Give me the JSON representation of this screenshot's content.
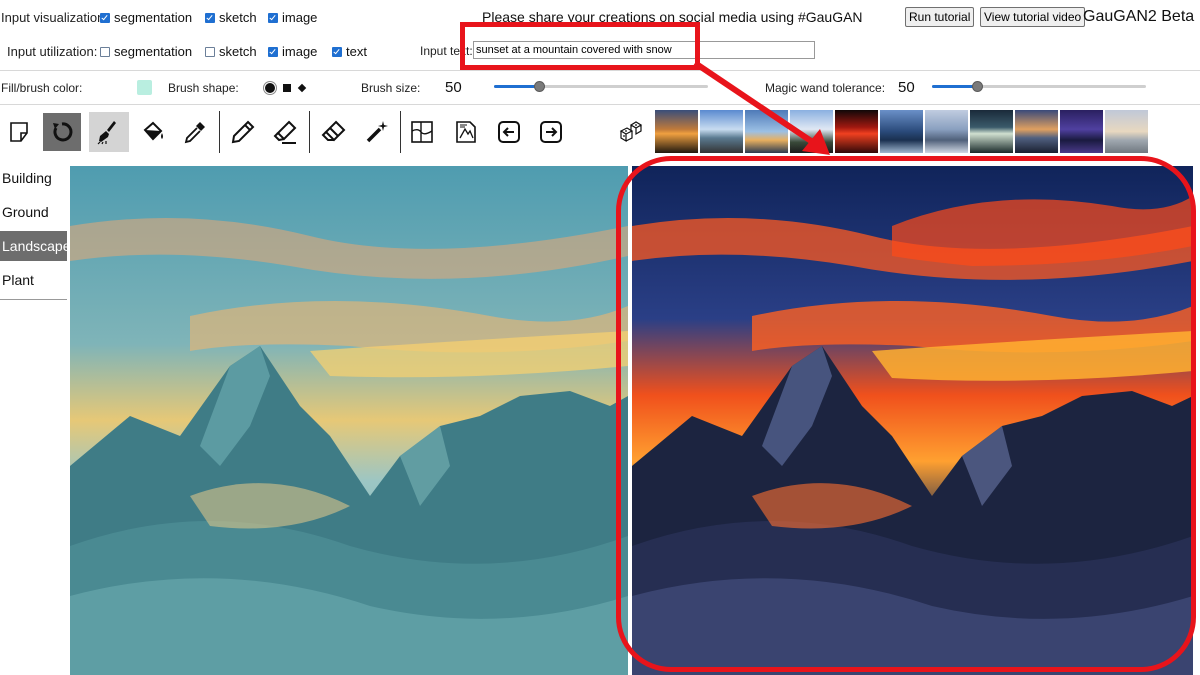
{
  "header": {
    "input_visualization_label": "Input visualization:",
    "input_utilization_label": "Input utilization:",
    "share_text": "Please share your creations on social media using #GauGAN",
    "run_tutorial_label": "Run tutorial",
    "view_tutorial_video_label": "View tutorial video",
    "app_title": "GauGAN2 Beta",
    "visualization_options": [
      {
        "label": "segmentation",
        "checked": true
      },
      {
        "label": "sketch",
        "checked": true
      },
      {
        "label": "image",
        "checked": true
      }
    ],
    "utilization_options": [
      {
        "label": "segmentation",
        "checked": false
      },
      {
        "label": "sketch",
        "checked": false
      },
      {
        "label": "image",
        "checked": true
      },
      {
        "label": "text",
        "checked": true
      }
    ],
    "input_text_label": "Input text:",
    "input_text_value": "sunset at a mountain covered with snow"
  },
  "brush_row": {
    "fill_brush_color_label": "Fill/brush color:",
    "fill_color": "#b9eee0",
    "brush_shape_label": "Brush shape:",
    "brush_size_label": "Brush size:",
    "brush_size_value": "50",
    "brush_size_fraction": 0.21,
    "magic_wand_label": "Magic wand tolerance:",
    "magic_wand_value": "50",
    "magic_wand_fraction": 0.21
  },
  "tools": [
    "new-canvas-icon",
    "undo-icon",
    "brush-icon",
    "fill-bucket-icon",
    "eyedropper-icon",
    "pencil-icon",
    "sketch-eraser-icon",
    "eraser-icon",
    "magic-wand-icon",
    "segment-icon",
    "sketch-image-icon",
    "arrow-left-icon",
    "arrow-right-icon",
    "random-dice-icon"
  ],
  "sidebar": {
    "items": [
      {
        "label": "Building",
        "active": false
      },
      {
        "label": "Ground",
        "active": false
      },
      {
        "label": "Landscape",
        "active": true
      },
      {
        "label": "Plant",
        "active": false
      }
    ]
  },
  "colors": {
    "annotation_red": "#e8141b",
    "active_tool_bg": "#6d6d6d",
    "active_sidebar_bg": "#6d6d6d"
  }
}
